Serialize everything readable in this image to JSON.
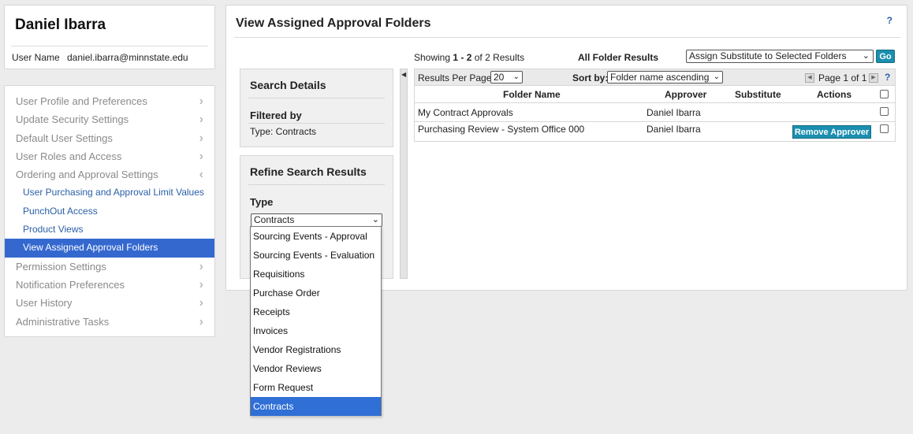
{
  "user": {
    "name": "Daniel Ibarra",
    "username_label": "User Name",
    "username_value": "daniel.ibarra@minnstate.edu"
  },
  "nav": {
    "items_top": [
      {
        "label": "User Profile and Preferences"
      },
      {
        "label": "Update Security Settings"
      },
      {
        "label": "Default User Settings"
      },
      {
        "label": "User Roles and Access"
      },
      {
        "label": "Ordering and Approval Settings"
      }
    ],
    "sub_items": [
      {
        "label": "User Purchasing and Approval Limit Values"
      },
      {
        "label": "PunchOut Access"
      },
      {
        "label": "Product Views"
      },
      {
        "label": "View Assigned Approval Folders"
      }
    ],
    "items_bottom": [
      {
        "label": "Permission Settings"
      },
      {
        "label": "Notification Preferences"
      },
      {
        "label": "User History"
      },
      {
        "label": "Administrative Tasks"
      }
    ]
  },
  "page": {
    "title": "View Assigned Approval Folders",
    "help": "?"
  },
  "search_details": {
    "title": "Search Details",
    "filtered_by": "Filtered by",
    "filter_value": "Type: Contracts"
  },
  "refine": {
    "title": "Refine Search Results",
    "type_label": "Type",
    "type_selected": "Contracts",
    "options": [
      "Sourcing Events - Approval",
      "Sourcing Events - Evaluation",
      "Requisitions",
      "Purchase Order",
      "Receipts",
      "Invoices",
      "Vendor Registrations",
      "Vendor Reviews",
      "Form Request",
      "Contracts"
    ]
  },
  "results": {
    "showing_prefix": "Showing ",
    "showing_range": "1 - 2",
    "showing_suffix": " of 2 Results",
    "all_results": "All Folder Results",
    "assign_action": "Assign Substitute to Selected Folders",
    "go": "Go",
    "rpp_label": "Results Per Page",
    "rpp_value": "20",
    "sort_label": "Sort by:",
    "sort_value": "Folder name ascending",
    "page_label": "Page 1 of 1",
    "help": "?",
    "columns": {
      "folder": "Folder Name",
      "approver": "Approver",
      "substitute": "Substitute",
      "actions": "Actions"
    },
    "rows": [
      {
        "folder": "My Contract Approvals",
        "approver": "Daniel Ibarra",
        "substitute": "",
        "action": ""
      },
      {
        "folder": "Purchasing Review - System Office 000",
        "approver": "Daniel Ibarra",
        "substitute": "",
        "action": "Remove Approver"
      }
    ]
  }
}
